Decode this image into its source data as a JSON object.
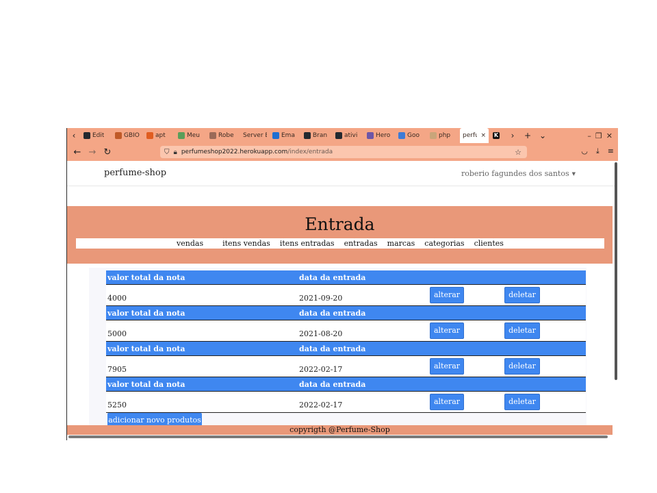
{
  "browser": {
    "tabs": [
      {
        "title": "Edit",
        "color": "#24292f"
      },
      {
        "title": "GBIO",
        "color": "#c05a28"
      },
      {
        "title": "apt",
        "color": "#e05d20"
      },
      {
        "title": "Meu",
        "color": "#5a9e5a"
      },
      {
        "title": "Robe",
        "color": "#9a6a58"
      },
      {
        "title": "Server E",
        "color": ""
      },
      {
        "title": "Ema",
        "color": "#1f6fd1"
      },
      {
        "title": "Bran",
        "color": "#24292f"
      },
      {
        "title": "ativi",
        "color": "#24292f"
      },
      {
        "title": "Hero",
        "color": "#6d56a7"
      },
      {
        "title": "Goo",
        "color": "#3e7bd6"
      },
      {
        "title": "php",
        "color": "#c9a57a"
      }
    ],
    "active_tab": {
      "title": "perfu",
      "close": "×"
    },
    "url_host": "perfumeshop2022.herokuapp.com",
    "url_path": "/index/entrada"
  },
  "site": {
    "brand": "perfume-shop",
    "user": "roberio fagundes dos santos",
    "page_title": "Entrada",
    "menu": [
      "vendas",
      "itens vendas",
      "itens entradas",
      "entradas",
      "marcas",
      "categorias",
      "clientes"
    ],
    "col_total": "valor total da nota",
    "col_date": "data da entrada",
    "rows": [
      {
        "total": "4000",
        "date": "2021-09-20"
      },
      {
        "total": "5000",
        "date": "2021-08-20"
      },
      {
        "total": "7905",
        "date": "2022-02-17"
      },
      {
        "total": "5250",
        "date": "2022-02-17"
      }
    ],
    "edit_label": "alterar",
    "delete_label": "deletar",
    "add_label": "adicionar novo produtos",
    "footer": "copyrigth @Perfume-Shop"
  }
}
